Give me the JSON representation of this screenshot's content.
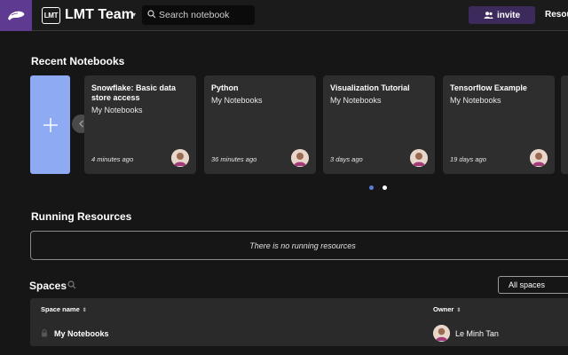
{
  "header": {
    "brand_icon": "app-logo-icon",
    "team_logo_text": "LMT",
    "team_name": "LMT Team",
    "search_placeholder": "Search notebook",
    "invite_label": "invite",
    "resources_label": "Resources",
    "accent_color": "#5e3a90"
  },
  "recent": {
    "title": "Recent Notebooks",
    "add_icon": "plus-icon",
    "add_color": "#8eaaf3",
    "notebooks": [
      {
        "title": "Snowflake: Basic data store access",
        "space": "My Notebooks",
        "time": "4 minutes ago"
      },
      {
        "title": "Python",
        "space": "My Notebooks",
        "time": "36 minutes ago"
      },
      {
        "title": "Visualization Tutorial",
        "space": "My Notebooks",
        "time": "3 days ago"
      },
      {
        "title": "Tensorflow Example",
        "space": "My Notebooks",
        "time": "19 days ago"
      }
    ],
    "pagination": {
      "pages": 2,
      "active": 1
    }
  },
  "running": {
    "title": "Running Resources",
    "empty_text": "There is no running resources"
  },
  "spaces": {
    "title": "Spaces",
    "filter_value": "All spaces",
    "columns": [
      "Space name",
      "Owner"
    ],
    "rows": [
      {
        "name": "My Notebooks",
        "owner": "Le Minh Tan"
      }
    ]
  }
}
